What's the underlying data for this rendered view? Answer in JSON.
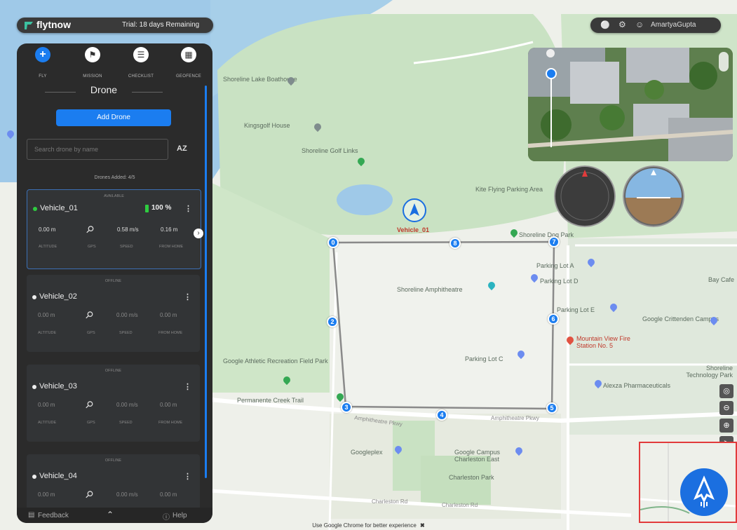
{
  "brand": {
    "name": "flytnow",
    "trial": "Trial: 18 days Remaining"
  },
  "top_right": {
    "user": "AmartyaGupta"
  },
  "nav": [
    {
      "label": "FLY",
      "icon": "plus-icon"
    },
    {
      "label": "MISSION",
      "icon": "flag-icon"
    },
    {
      "label": "CHECKLIST",
      "icon": "checklist-icon"
    },
    {
      "label": "GEOFENCE",
      "icon": "grid-icon"
    }
  ],
  "panel": {
    "title": "Drone",
    "add_button": "Add Drone",
    "search_placeholder": "Search drone by name",
    "sort_label": "AZ",
    "count": "Drones Added: 4/5",
    "feedback": "Feedback",
    "help": "Help"
  },
  "vehicles": [
    {
      "status": "AVAILABLE",
      "name": "Vehicle_01",
      "battery": "100 %",
      "altitude": "0.00 m",
      "speed": "0.58 m/s",
      "home": "0.16 m",
      "online": true
    },
    {
      "status": "OFFLINE",
      "name": "Vehicle_02",
      "altitude": "0.00 m",
      "speed": "0.00 m/s",
      "home": "0.00 m",
      "online": false
    },
    {
      "status": "OFFLINE",
      "name": "Vehicle_03",
      "altitude": "0.00 m",
      "speed": "0.00 m/s",
      "home": "0.00 m",
      "online": false
    },
    {
      "status": "OFFLINE",
      "name": "Vehicle_04",
      "altitude": "0.00 m",
      "speed": "0.00 m/s",
      "home": "0.00 m",
      "online": false
    }
  ],
  "stat_labels": {
    "altitude": "ALTITUDE",
    "gps": "GPS",
    "speed": "SPEED",
    "home": "FROM HOME"
  },
  "map_labels": {
    "lake": "Shoreline Lake Boathouse",
    "golf_house": "Kingsgolf House",
    "golf": "Shoreline Golf Links",
    "kite": "Kite Flying Parking Area",
    "dog_park": "Shoreline Dog Park",
    "lot_a": "Parking Lot A",
    "lot_d": "Parking Lot D",
    "lot_e": "Parking Lot E",
    "lot_c": "Parking Lot C",
    "amphitheatre": "Shoreline Amphitheatre",
    "athletic": "Google Athletic Recreation Field Park",
    "permanente": "Permanente Creek Trail",
    "fire": "Mountain View Fire Station No. 5",
    "crittenden": "Google Crittenden Campus",
    "tech_park": "Shoreline Technology Park",
    "alexza": "Alexza Pharmaceuticals",
    "googleplex": "Googleplex",
    "charleston_east": "Google Campus Charleston East",
    "charleston_park": "Charleston Park",
    "amphitheatre_pkwy": "Amphitheatre Pkwy",
    "charleston_rd": "Charleston Rd",
    "bay_cafe": "Bay Cafe",
    "vehicle_marker": "Vehicle_01"
  },
  "waypoints": [
    "0",
    "2",
    "3",
    "4",
    "5",
    "6",
    "7",
    "8"
  ],
  "footer": "Use Google Chrome for better experience"
}
